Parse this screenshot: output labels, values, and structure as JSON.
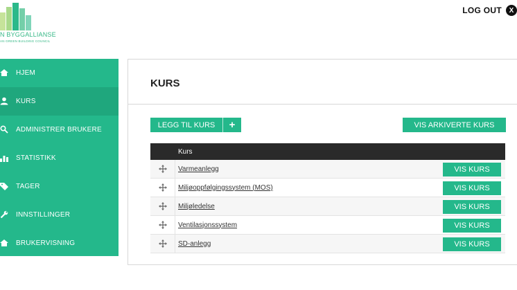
{
  "logo": {
    "name": "N BYGGALLIANSE",
    "tagline": "AN GREEN BUILDING COUNCIL",
    "colors": [
      "#2bb98a",
      "#74cfa9",
      "#a9d98a",
      "#c6e39a"
    ]
  },
  "header": {
    "logout_label": "LOG OUT",
    "logout_icon_glyph": "X"
  },
  "sidebar": {
    "items": [
      {
        "label": "HJEM",
        "icon": "home-icon"
      },
      {
        "label": "KURS",
        "icon": "user-icon"
      },
      {
        "label": "ADMINISTRER BRUKERE",
        "icon": "search-icon"
      },
      {
        "label": "STATISTIKK",
        "icon": "chart-icon"
      },
      {
        "label": "TAGER",
        "icon": "tag-icon"
      },
      {
        "label": "INNSTILLINGER",
        "icon": "wrench-icon"
      },
      {
        "label": "BRUKERVISNING",
        "icon": "home-icon"
      }
    ],
    "active_index": 1
  },
  "main": {
    "title": "KURS",
    "add_button_label": "LEGG TIL KURS",
    "add_button_plus": "+",
    "archive_button_label": "VIS ARKIVERTE KURS",
    "table": {
      "header": "Kurs",
      "rows": [
        {
          "name": "Varmeanlegg",
          "button": "VIS KURS"
        },
        {
          "name": "Miljøoppfølgingssystem (MOS)",
          "button": "VIS KURS"
        },
        {
          "name": "Miljøledelse",
          "button": "VIS KURS"
        },
        {
          "name": "Ventilasjonssystem",
          "button": "VIS KURS"
        },
        {
          "name": "SD-anlegg",
          "button": "VIS KURS"
        }
      ]
    }
  },
  "colors": {
    "accent": "#24b88b",
    "accent_active": "#1fa77d",
    "table_header": "#2a2a2a"
  }
}
